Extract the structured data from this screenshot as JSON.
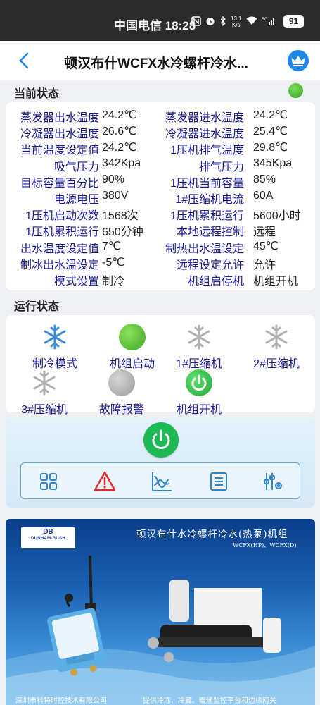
{
  "status_bar": {
    "carrier_time": "中国电信 18:28",
    "speed_value": "13.1",
    "speed_unit": "K/s",
    "battery": "91"
  },
  "header": {
    "title": "顿汉布什WCFX水冷螺杆冷水..."
  },
  "current_status": {
    "title": "当前状态",
    "indicator_color": "#3fae2a",
    "rows": [
      {
        "l1": "蒸发器出水温度",
        "v1": "24.2℃",
        "l2": "蒸发器进水温度",
        "v2": "24.2℃"
      },
      {
        "l1": "冷凝器出水温度",
        "v1": "26.6℃",
        "l2": "冷凝器进水温度",
        "v2": "25.4℃"
      },
      {
        "l1": "当前温度设定值",
        "v1": "24.2℃",
        "l2": "1压机排气温度",
        "v2": "29.8℃"
      },
      {
        "l1": "吸气压力",
        "v1": "342Kpa",
        "l2": "排气压力",
        "v2": "345Kpa"
      },
      {
        "l1": "目标容量百分比",
        "v1": "90%",
        "l2": "1压机当前容量",
        "v2": "85%"
      },
      {
        "l1": "电源电压",
        "v1": "380V",
        "l2": "1#压缩机电流",
        "v2": "60A"
      },
      {
        "l1": "1压机启动次数",
        "v1": "1568次",
        "l2": "1压机累积运行",
        "v2": "5600小时"
      },
      {
        "l1": "1压机累积运行",
        "v1": "650分钟",
        "l2": "本地远程控制",
        "v2": "远程"
      },
      {
        "l1": "出水温度设定值",
        "v1": "7℃",
        "l2": "制热出水温设定",
        "v2": "45℃"
      },
      {
        "l1": "制冰出水温设定",
        "v1": "-5℃",
        "l2": "远程设定允许",
        "v2": "允许"
      },
      {
        "l1": "模式设置",
        "v1": "制冷",
        "l2": "机组启停机",
        "v2": "机组开机"
      }
    ]
  },
  "run_status": {
    "title": "运行状态",
    "items": [
      {
        "label": "制冷模式",
        "icon": "snowflake-blue-icon"
      },
      {
        "label": "机组启动",
        "icon": "green-ball-icon"
      },
      {
        "label": "1#压缩机",
        "icon": "snowflake-gray-icon"
      },
      {
        "label": "2#压缩机",
        "icon": "snowflake-gray-icon"
      },
      {
        "label": "3#压缩机",
        "icon": "snowflake-gray-icon"
      },
      {
        "label": "故障报警",
        "icon": "gray-ball-icon"
      },
      {
        "label": "机组开机",
        "icon": "power-green-icon"
      }
    ]
  },
  "controls": {
    "power_icon": "power-icon",
    "nav": [
      "grid-icon",
      "alarm-warning-icon",
      "trend-chart-icon",
      "list-icon",
      "settings-sliders-icon"
    ]
  },
  "banner": {
    "logo_db": "DB",
    "logo_name": "DUNHAM-BUSH",
    "title": "顿汉布什水冷螺杆冷水(热泵)机组",
    "subtitle": "WCFX(HP)、WCFX(D)",
    "footer_left": "深圳市科特时控技术有限公司",
    "footer_right": "提供冷冻、冷藏、暖通监控平台和边缘网关"
  },
  "colors": {
    "label_blue": "#1a1a99",
    "accent_blue": "#1e88e5",
    "power_green": "#1db954"
  }
}
